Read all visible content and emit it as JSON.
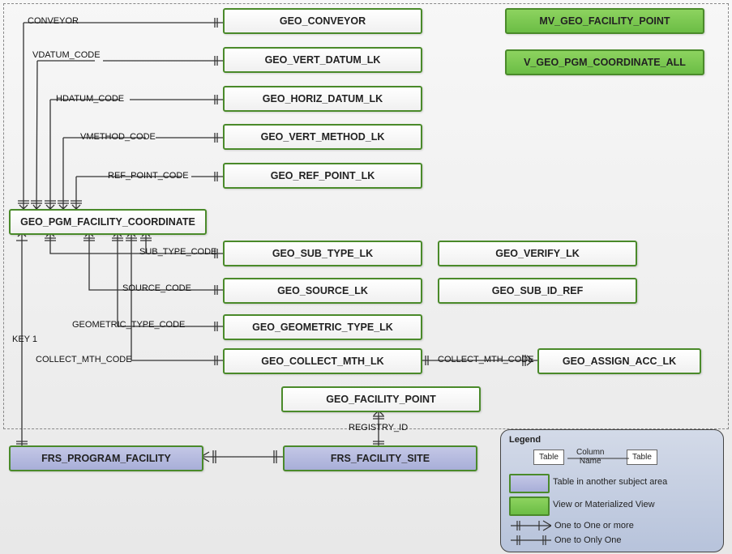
{
  "entities": {
    "conveyor": "GEO_CONVEYOR",
    "vert_datum": "GEO_VERT_DATUM_LK",
    "horiz_datum": "GEO_HORIZ_DATUM_LK",
    "vert_method": "GEO_VERT_METHOD_LK",
    "ref_point": "GEO_REF_POINT_LK",
    "coord": "GEO_PGM_FACILITY_COORDINATE",
    "sub_type": "GEO_SUB_TYPE_LK",
    "source": "GEO_SOURCE_LK",
    "geometric": "GEO_GEOMETRIC_TYPE_LK",
    "collect": "GEO_COLLECT_MTH_LK",
    "facility_point": "GEO_FACILITY_POINT",
    "verify": "GEO_VERIFY_LK",
    "sub_id_ref": "GEO_SUB_ID_REF",
    "assign": "GEO_ASSIGN_ACC_LK",
    "mv_point": "MV_GEO_FACILITY_POINT",
    "v_all": "V_GEO_PGM_COORDINATE_ALL",
    "program": "FRS_PROGRAM_FACILITY",
    "site": "FRS_FACILITY_SITE"
  },
  "labels": {
    "conveyor": "CONVEYOR",
    "vdatum": "VDATUM_CODE",
    "hdatum": "HDATUM_CODE",
    "vmethod": "VMETHOD_CODE",
    "ref_point": "REF_POINT_CODE",
    "sub_type": "SUB_TYPE_CODE",
    "source": "SOURCE_CODE",
    "geometric": "GEOMETRIC_TYPE_CODE",
    "collect1": "COLLECT_MTH_CODE",
    "collect2": "COLLECT_MTH_CODE",
    "key": "KEY 1",
    "registry": "REGISTRY_ID"
  },
  "legend": {
    "title": "Legend",
    "table": "Table",
    "column": "Column\nName",
    "other_area": "Table in another subject area",
    "view": "View or Materialized View",
    "one_more": "One to One or more",
    "one_only": "One to Only One"
  }
}
